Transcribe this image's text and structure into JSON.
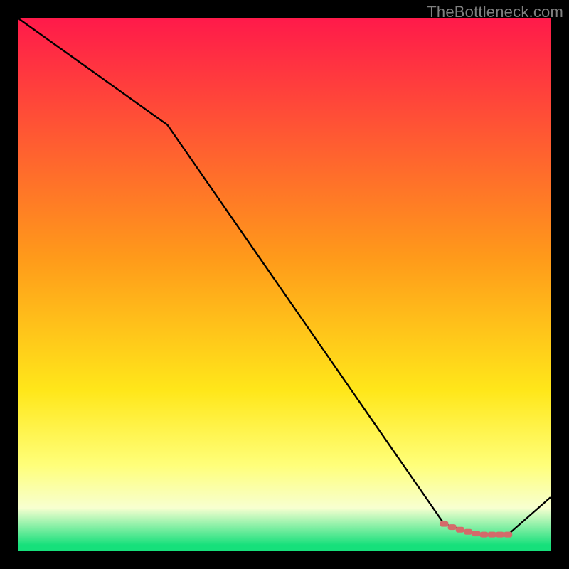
{
  "watermark": "TheBottleneck.com",
  "colors": {
    "top": "#ff1a4a",
    "mid_upper": "#ff9a1a",
    "mid": "#ffe71a",
    "lower_yellow": "#ffff7a",
    "pale": "#f7ffd0",
    "green": "#16e07b",
    "line": "#000000",
    "marker": "#d46a6a",
    "page_bg": "#000000"
  },
  "chart_data": {
    "type": "line",
    "title": "",
    "xlabel": "",
    "ylabel": "",
    "xlim": [
      0,
      100
    ],
    "ylim": [
      0,
      100
    ],
    "series": [
      {
        "name": "bottleneck-curve",
        "x": [
          0,
          28,
          80,
          86,
          92,
          100
        ],
        "y": [
          100,
          80,
          5,
          3,
          3,
          10
        ]
      }
    ],
    "markers": {
      "name": "highlight-segment",
      "x": [
        80,
        81.5,
        83,
        84.5,
        86,
        87.5,
        89,
        90.5,
        92
      ],
      "y": [
        5,
        4.4,
        3.9,
        3.5,
        3.2,
        3.0,
        3.0,
        3.0,
        3.0
      ]
    },
    "gradient_stops": [
      {
        "pct": 0,
        "color": "#ff1a4a"
      },
      {
        "pct": 45,
        "color": "#ff9a1a"
      },
      {
        "pct": 70,
        "color": "#ffe71a"
      },
      {
        "pct": 84,
        "color": "#ffff7a"
      },
      {
        "pct": 92,
        "color": "#f7ffd0"
      },
      {
        "pct": 99,
        "color": "#16e07b"
      },
      {
        "pct": 100,
        "color": "#16e07b"
      }
    ]
  }
}
